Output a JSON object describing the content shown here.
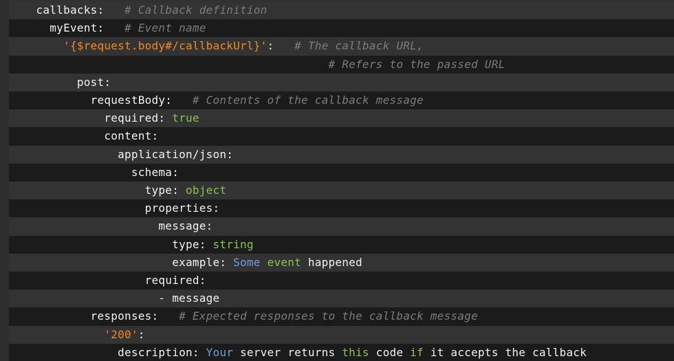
{
  "editor": {
    "colors": {
      "background": "#323232",
      "band_dark": "#1b1b1b",
      "band_light": "#333333",
      "key": "#f2f2f2",
      "comment": "#7c7c7c",
      "string": "#f08a24",
      "literal": "#8bc34a",
      "word": "#6f9fd8"
    },
    "lines": [
      {
        "indent": 2,
        "band": "light",
        "tokens": [
          {
            "t": "key",
            "v": "callbacks:"
          },
          {
            "t": "plain",
            "v": "   "
          },
          {
            "t": "comment",
            "v": "# Callback definition"
          }
        ]
      },
      {
        "indent": 3,
        "band": "dark",
        "tokens": [
          {
            "t": "key",
            "v": "myEvent:"
          },
          {
            "t": "plain",
            "v": "   "
          },
          {
            "t": "comment",
            "v": "# Event name"
          }
        ]
      },
      {
        "indent": 4,
        "band": "light",
        "tokens": [
          {
            "t": "string",
            "v": "'{$request.body#/callbackUrl}'"
          },
          {
            "t": "key",
            "v": ":"
          },
          {
            "t": "plain",
            "v": "   "
          },
          {
            "t": "comment",
            "v": "# The callback URL,"
          }
        ]
      },
      {
        "indent": 0,
        "band": "dark",
        "tokens": [
          {
            "t": "plain",
            "v": "                                               "
          },
          {
            "t": "comment",
            "v": "# Refers to the passed URL"
          }
        ]
      },
      {
        "indent": 5,
        "band": "light",
        "tokens": [
          {
            "t": "key",
            "v": "post:"
          }
        ]
      },
      {
        "indent": 6,
        "band": "dark",
        "tokens": [
          {
            "t": "key",
            "v": "requestBody:"
          },
          {
            "t": "plain",
            "v": "   "
          },
          {
            "t": "comment",
            "v": "# Contents of the callback message"
          }
        ]
      },
      {
        "indent": 7,
        "band": "light",
        "tokens": [
          {
            "t": "key",
            "v": "required:"
          },
          {
            "t": "plain",
            "v": " "
          },
          {
            "t": "literal",
            "v": "true"
          }
        ]
      },
      {
        "indent": 7,
        "band": "dark",
        "tokens": [
          {
            "t": "key",
            "v": "content:"
          }
        ]
      },
      {
        "indent": 8,
        "band": "light",
        "tokens": [
          {
            "t": "key",
            "v": "application/json:"
          }
        ]
      },
      {
        "indent": 9,
        "band": "dark",
        "tokens": [
          {
            "t": "key",
            "v": "schema:"
          }
        ]
      },
      {
        "indent": 10,
        "band": "light",
        "tokens": [
          {
            "t": "key",
            "v": "type:"
          },
          {
            "t": "plain",
            "v": " "
          },
          {
            "t": "literal",
            "v": "object"
          }
        ]
      },
      {
        "indent": 10,
        "band": "dark",
        "tokens": [
          {
            "t": "key",
            "v": "properties:"
          }
        ]
      },
      {
        "indent": 11,
        "band": "light",
        "tokens": [
          {
            "t": "key",
            "v": "message:"
          }
        ]
      },
      {
        "indent": 12,
        "band": "dark",
        "tokens": [
          {
            "t": "key",
            "v": "type:"
          },
          {
            "t": "plain",
            "v": " "
          },
          {
            "t": "literal",
            "v": "string"
          }
        ]
      },
      {
        "indent": 12,
        "band": "light",
        "tokens": [
          {
            "t": "key",
            "v": "example:"
          },
          {
            "t": "plain",
            "v": " "
          },
          {
            "t": "word",
            "v": "Some"
          },
          {
            "t": "plain",
            "v": " "
          },
          {
            "t": "literal",
            "v": "event"
          },
          {
            "t": "plain",
            "v": " happened"
          }
        ]
      },
      {
        "indent": 10,
        "band": "dark",
        "tokens": [
          {
            "t": "key",
            "v": "required:"
          }
        ]
      },
      {
        "indent": 11,
        "band": "light",
        "tokens": [
          {
            "t": "dash",
            "v": "- "
          },
          {
            "t": "plain",
            "v": "message"
          }
        ]
      },
      {
        "indent": 6,
        "band": "dark",
        "tokens": [
          {
            "t": "key",
            "v": "responses:"
          },
          {
            "t": "plain",
            "v": "   "
          },
          {
            "t": "comment",
            "v": "# Expected responses to the callback message"
          }
        ]
      },
      {
        "indent": 7,
        "band": "light",
        "tokens": [
          {
            "t": "string",
            "v": "'200'"
          },
          {
            "t": "key",
            "v": ":"
          }
        ]
      },
      {
        "indent": 8,
        "band": "dark",
        "tokens": [
          {
            "t": "key",
            "v": "description:"
          },
          {
            "t": "plain",
            "v": " "
          },
          {
            "t": "word",
            "v": "Your"
          },
          {
            "t": "plain",
            "v": " server returns "
          },
          {
            "t": "literal",
            "v": "this"
          },
          {
            "t": "plain",
            "v": " code "
          },
          {
            "t": "literal",
            "v": "if"
          },
          {
            "t": "plain",
            "v": " it accepts the callback"
          }
        ]
      }
    ]
  }
}
